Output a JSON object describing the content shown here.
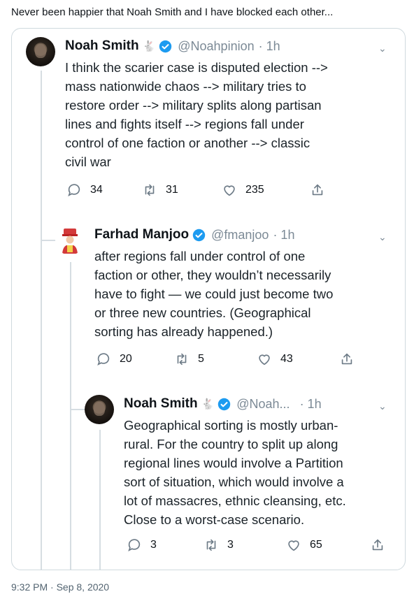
{
  "caption": "Never been happier that Noah Smith and I have blocked each other...",
  "timestamp": "9:32 PM · Sep 8, 2020",
  "tweets": [
    {
      "name": "Noah Smith",
      "handle": "@Noahpinion",
      "time": "· 1h",
      "lines": [
        "I think the scarier case is disputed election -->",
        "mass nationwide chaos --> military tries to",
        "restore order --> military splits along partisan",
        "lines and fights itself --> regions fall under",
        "control of one faction or another --> classic",
        "civil war"
      ],
      "replies": "34",
      "retweets": "31",
      "likes": "235"
    },
    {
      "name": "Farhad Manjoo",
      "handle": "@fmanjoo",
      "time": "· 1h",
      "lines": [
        "after regions fall under control of one",
        "faction or other, they wouldn’t necessarily",
        "have to fight — we could just become two",
        "or three new countries. (Geographical",
        "sorting has already happened.)"
      ],
      "replies": "20",
      "retweets": "5",
      "likes": "43"
    },
    {
      "name": "Noah Smith",
      "handle": "@Noah...",
      "time": "· 1h",
      "lines": [
        "Geographical sorting is mostly urban-",
        "rural. For the country to split up along",
        "regional lines would involve a Partition",
        "sort of situation, which would involve a",
        "lot of massacres, ethnic cleansing, etc.",
        "Close to a worst-case scenario."
      ],
      "replies": "3",
      "retweets": "3",
      "likes": "65"
    }
  ]
}
